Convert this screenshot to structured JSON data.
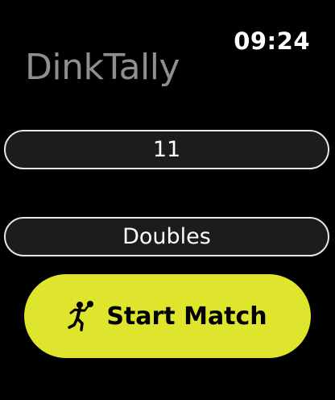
{
  "status": {
    "time": "09:24"
  },
  "app": {
    "title": "DinkTally"
  },
  "pickers": {
    "points_value": "11",
    "mode_value": "Doubles"
  },
  "actions": {
    "start_label": "Start Match",
    "start_icon": "running-player-icon"
  },
  "colors": {
    "background": "#000000",
    "accent": "#dfe52c",
    "title": "#8e8e93",
    "picker_fill": "#1c1c1e"
  }
}
